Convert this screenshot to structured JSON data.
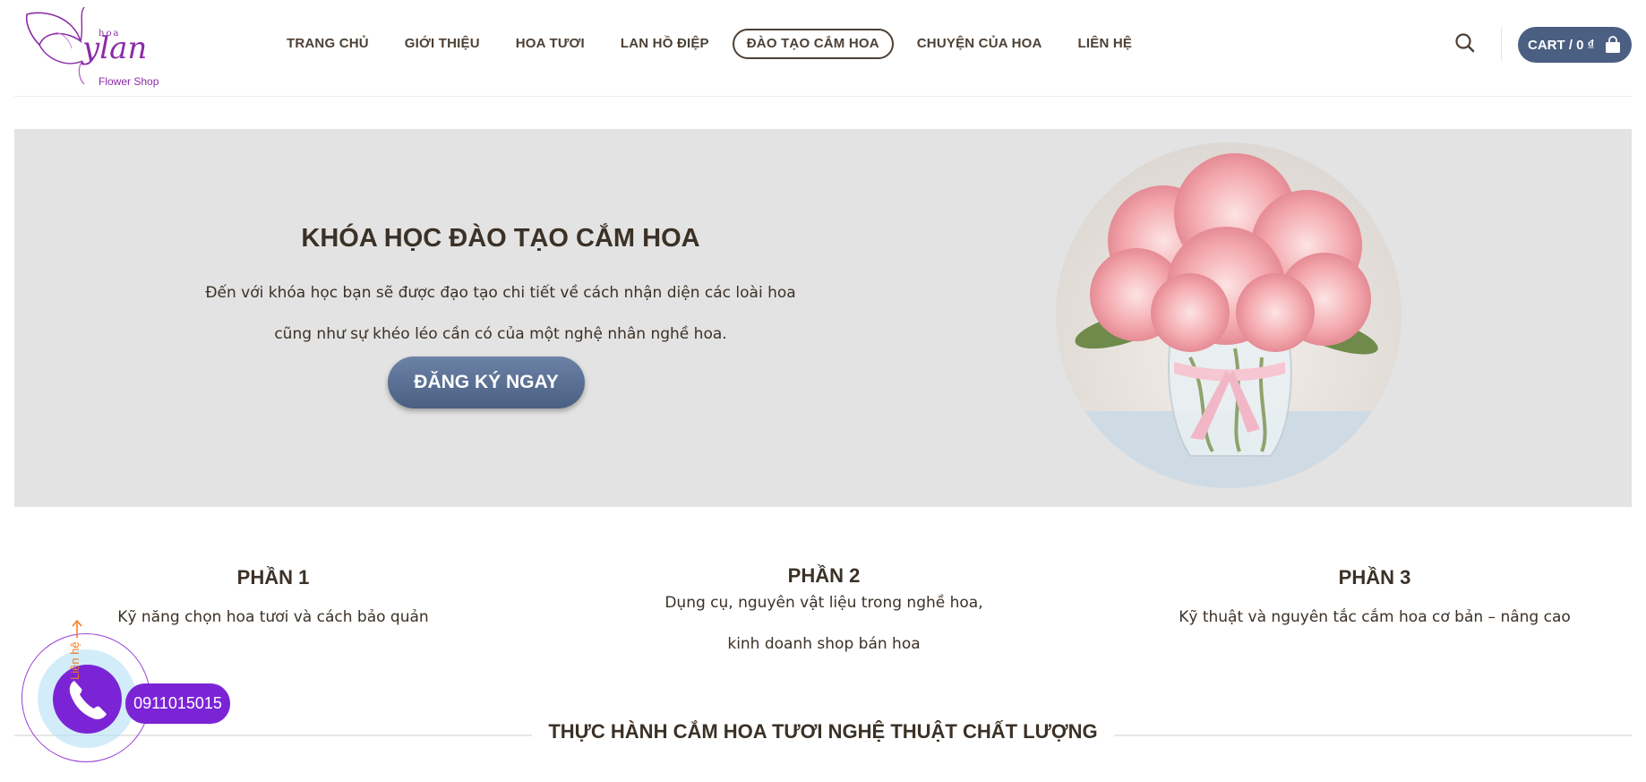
{
  "brand": {
    "logo_small": "hoa",
    "logo_main": "ylan",
    "logo_sub": "Flower Shop"
  },
  "nav": {
    "items": [
      {
        "label": "TRANG CHỦ",
        "active": false
      },
      {
        "label": "GIỚI THIỆU",
        "active": false
      },
      {
        "label": "HOA TƯƠI",
        "active": false
      },
      {
        "label": "LAN HỒ ĐIỆP",
        "active": false
      },
      {
        "label": "ĐÀO TẠO CẮM HOA",
        "active": true
      },
      {
        "label": "CHUYỆN CỦA HOA",
        "active": false
      },
      {
        "label": "LIÊN HỆ",
        "active": false
      }
    ]
  },
  "header": {
    "search_icon": "search-icon",
    "cart_label": "CART / 0 ₫",
    "cart_icon": "shopping-bag-icon"
  },
  "hero": {
    "title": "KHÓA HỌC ĐÀO TẠO CẮM HOA",
    "line1": "Đến với khóa học bạn sẽ được đạo tạo chi tiết về cách nhận diện các loài hoa",
    "line2": "cũng như sự khéo léo cần có của một nghệ nhân nghề hoa.",
    "button": "ĐĂNG KÝ NGAY"
  },
  "parts": [
    {
      "title": "PHẦN 1",
      "lines": [
        "Kỹ năng chọn hoa tươi và cách bảo quản"
      ]
    },
    {
      "title": "PHẦN 2",
      "lines": [
        "Dụng cụ, nguyên vật liệu trong nghề hoa,",
        "kinh doanh shop bán hoa"
      ]
    },
    {
      "title": "PHẦN 3",
      "lines": [
        "Kỹ thuật và nguyên tắc cắm hoa cơ bản – nâng cao"
      ]
    }
  ],
  "section": {
    "title": "THỰC HÀNH CẮM HOA TƯƠI NGHỆ THUẬT CHẤT LƯỢNG"
  },
  "float_contact": {
    "label": "Liên hệ",
    "phone": "0911015015",
    "icon": "phone-icon"
  },
  "colors": {
    "accent_blue": "#4a5f82",
    "contact_purple": "#7b24d6",
    "text_brown": "#3b3127",
    "hero_bg": "#e3e3e3"
  }
}
